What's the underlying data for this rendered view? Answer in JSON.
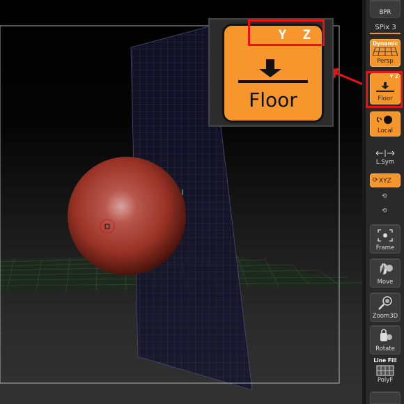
{
  "shelf": {
    "bpr_label": "BPR",
    "spix_label": "SPix 3",
    "persp": {
      "title": "Dynamic",
      "label": "Persp"
    },
    "floor": {
      "axes": "Y Z",
      "label": "Floor"
    },
    "local_label": "Local",
    "lsym_label": "L.Sym",
    "xyz_label": "XYZ",
    "frame_label": "Frame",
    "move_label": "Move",
    "zoom_label": "Zoom3D",
    "rotate_label": "Rotate",
    "polyf": {
      "title": "Line Fill",
      "label": "PolyF"
    }
  },
  "callout": {
    "axes": "Y Z",
    "label": "Floor"
  },
  "colors": {
    "accent_orange": "#f5962a",
    "highlight_red": "#ee1111",
    "sphere_red": "#a8382a",
    "floor_grid_green": "#2f4a2f",
    "wall_grid_blue": "#2d2d4a"
  },
  "icons": [
    "floor-icon",
    "local-icon",
    "lsym-icon",
    "xyz-icon",
    "frame-icon",
    "move-icon",
    "zoom-icon",
    "rotate-icon",
    "polyf-icon",
    "arrow-icon"
  ]
}
